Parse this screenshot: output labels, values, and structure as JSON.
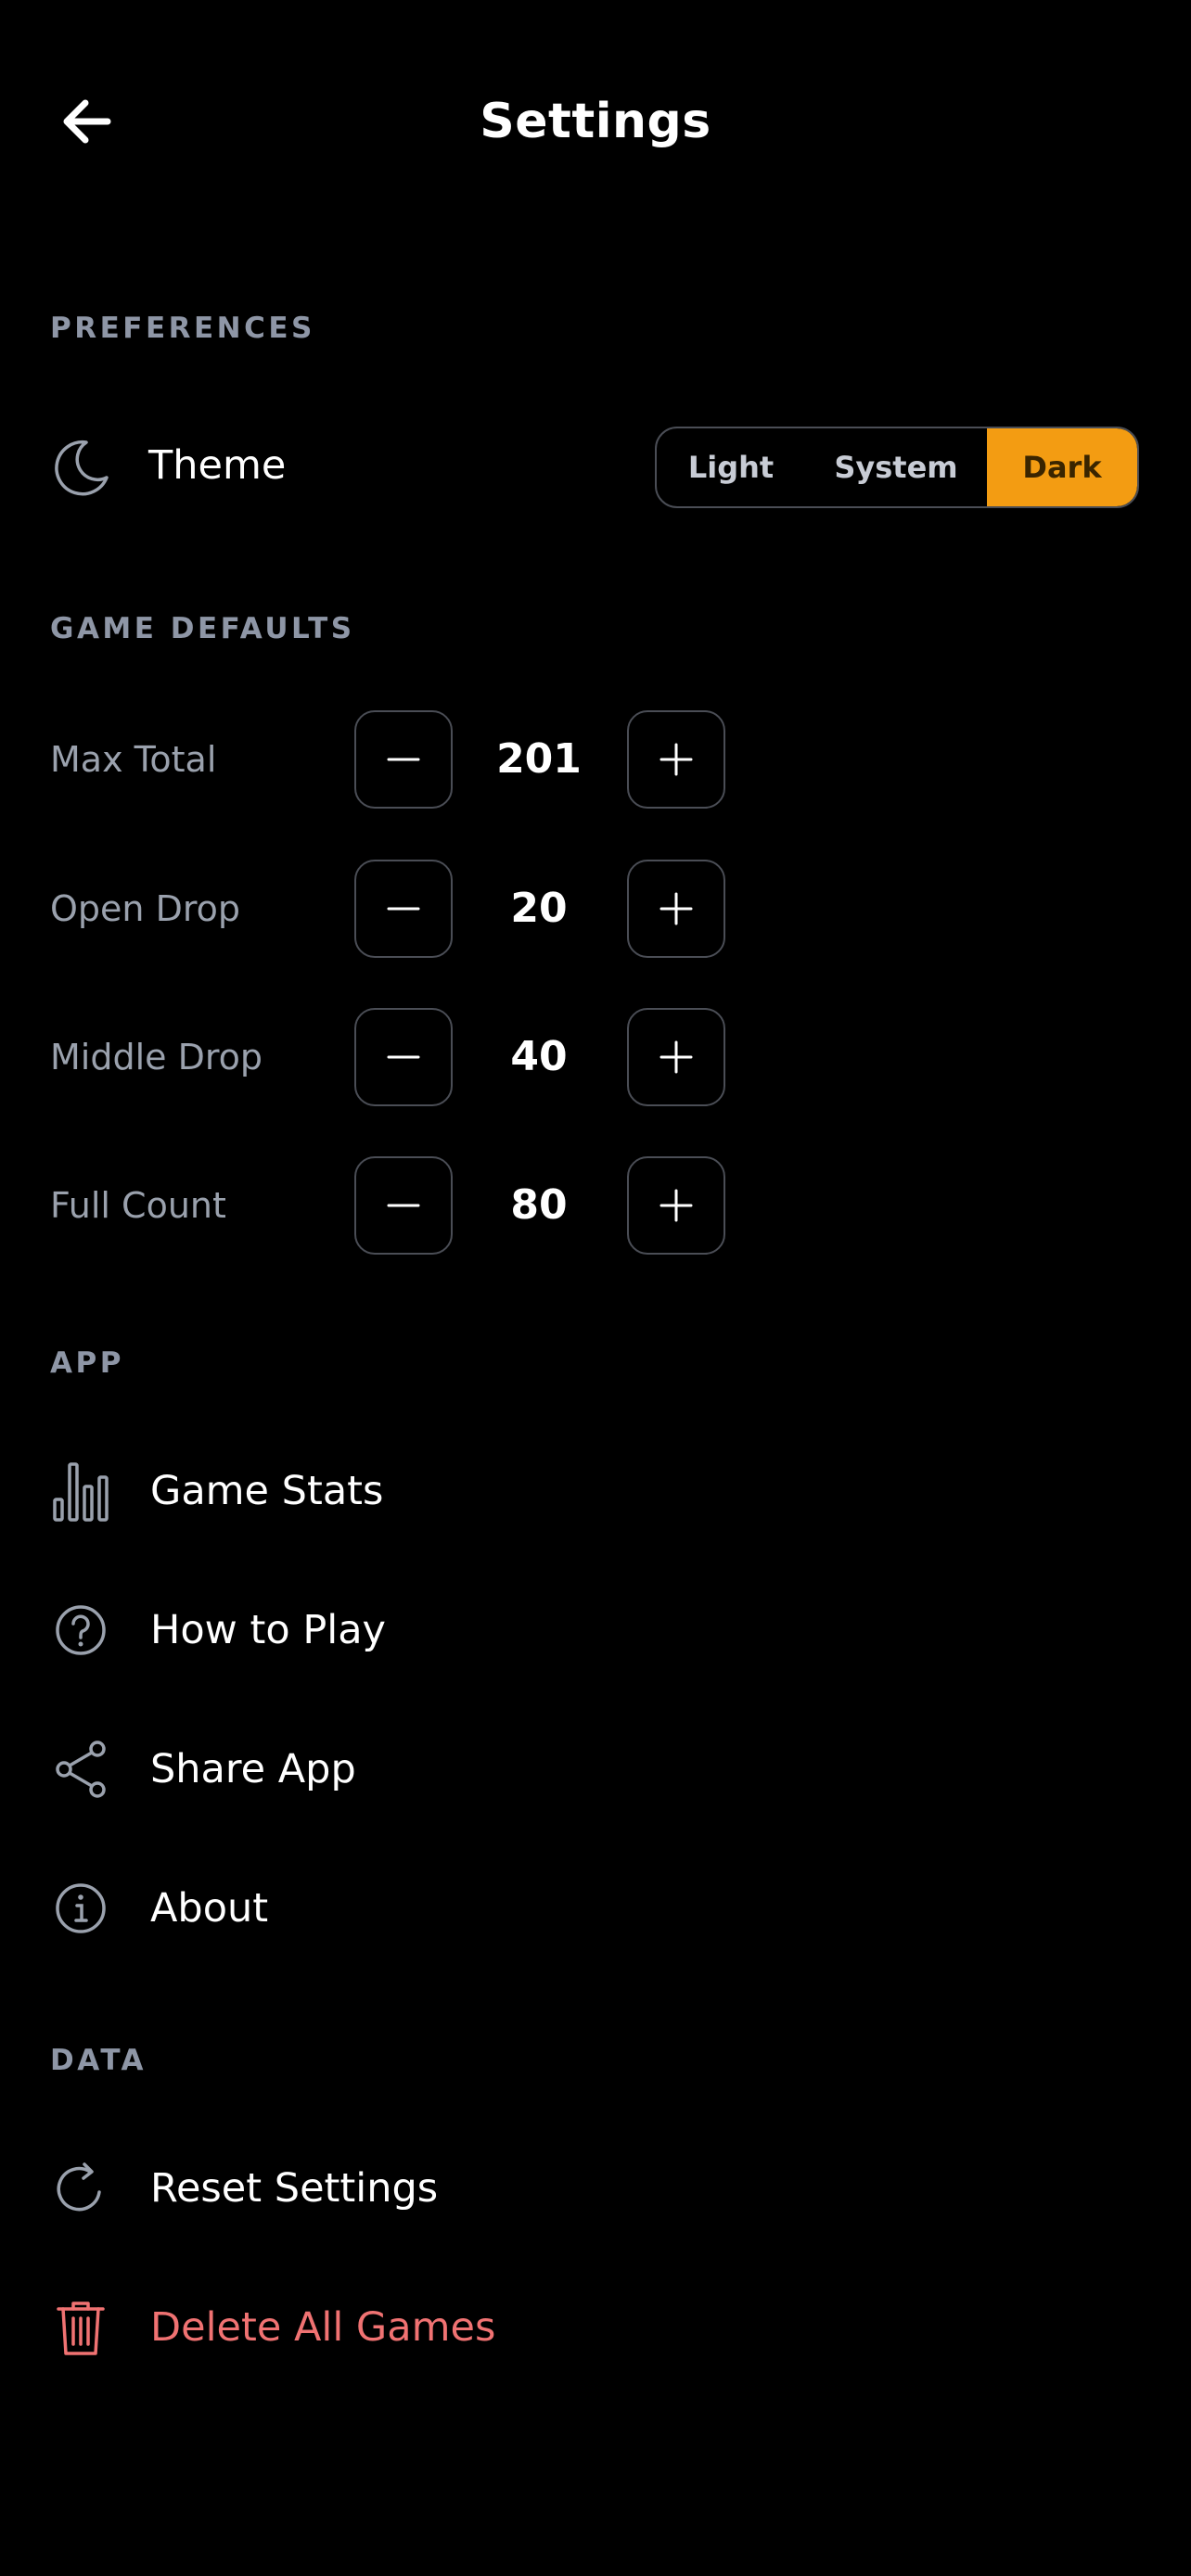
{
  "header": {
    "title": "Settings",
    "back_icon": "arrow-left-icon"
  },
  "preferences": {
    "section_title": "PREFERENCES",
    "theme": {
      "label": "Theme",
      "icon": "moon-icon",
      "options": [
        "Light",
        "System",
        "Dark"
      ],
      "selected": "Dark",
      "accent_color": "#f39c12"
    }
  },
  "game_defaults": {
    "section_title": "GAME DEFAULTS",
    "items": [
      {
        "label": "Max Total",
        "value": "201"
      },
      {
        "label": "Open Drop",
        "value": "20"
      },
      {
        "label": "Middle Drop",
        "value": "40"
      },
      {
        "label": "Full Count",
        "value": "80"
      }
    ]
  },
  "app": {
    "section_title": "APP",
    "items": [
      {
        "label": "Game Stats",
        "icon": "bar-chart-icon"
      },
      {
        "label": "How to Play",
        "icon": "help-circle-icon"
      },
      {
        "label": "Share App",
        "icon": "share-icon"
      },
      {
        "label": "About",
        "icon": "info-icon"
      }
    ]
  },
  "data_section": {
    "section_title": "DATA",
    "items": [
      {
        "label": "Reset Settings",
        "icon": "refresh-icon"
      },
      {
        "label": "Delete All Games",
        "icon": "trash-icon",
        "color": "#f07272"
      }
    ]
  }
}
